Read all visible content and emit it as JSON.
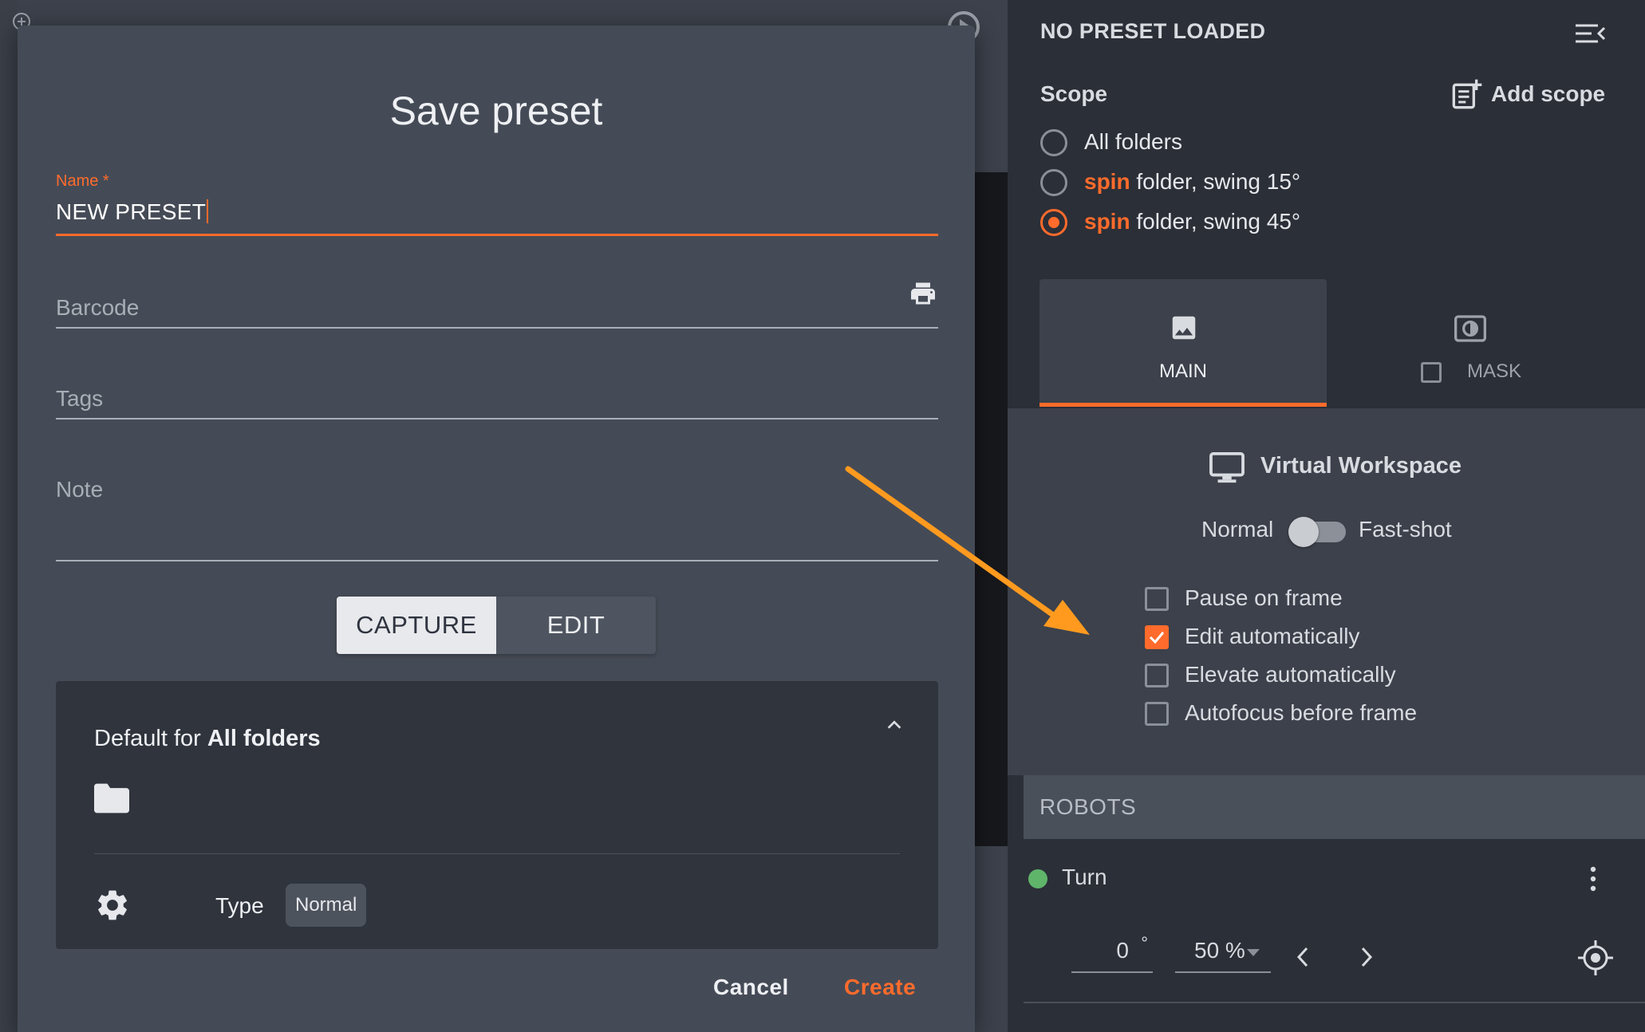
{
  "dialog": {
    "title": "Save preset",
    "name_label": "Name *",
    "name_value": "NEW PRESET",
    "barcode_placeholder": "Barcode",
    "tags_placeholder": "Tags",
    "note_placeholder": "Note",
    "segment_capture": "CAPTURE",
    "segment_edit": "EDIT",
    "defaults_prefix": "Default for ",
    "defaults_target": "All folders",
    "type_label": "Type",
    "type_value": "Normal",
    "cancel_label": "Cancel",
    "create_label": "Create"
  },
  "panel": {
    "title": "NO PRESET LOADED",
    "scope_label": "Scope",
    "add_scope_label": "Add scope",
    "scopes": [
      {
        "highlight": "",
        "text": "All folders",
        "selected": false
      },
      {
        "highlight": "spin",
        "text": " folder, swing 15°",
        "selected": false
      },
      {
        "highlight": "spin",
        "text": " folder, swing 45°",
        "selected": true
      }
    ],
    "tabs": [
      {
        "label": "MAIN",
        "active": true
      },
      {
        "label": "MASK",
        "active": false
      }
    ],
    "virtual_workspace_title": "Virtual Workspace",
    "mode_left": "Normal",
    "mode_right": "Fast-shot",
    "fast_shot_enabled": false,
    "options": [
      {
        "label": "Pause on frame",
        "checked": false
      },
      {
        "label": "Edit automatically",
        "checked": true
      },
      {
        "label": "Elevate automatically",
        "checked": false
      },
      {
        "label": "Autofocus before frame",
        "checked": false
      }
    ],
    "robots_header": "ROBOTS",
    "robot": {
      "name": "Turn",
      "status_color": "#5fb56a",
      "angle_value": "0",
      "angle_unit": "°",
      "speed_value": "50 %"
    }
  },
  "colors": {
    "accent": "#ff6b2c",
    "arrow": "#ff9a1f"
  },
  "icons": {
    "barcode_print": "printer-icon",
    "folder": "folder-icon",
    "settings": "gear-icon",
    "collapse": "chevron-up-icon",
    "menu": "menu-collapse-icon",
    "add_scope": "add-note-icon",
    "main_tab": "image-icon",
    "mask_tab": "mask-icon",
    "workspace": "monitor-icon",
    "robot_more": "more-vertical-icon",
    "prev": "chevron-left-icon",
    "next": "chevron-right-icon",
    "target": "crosshair-icon"
  }
}
